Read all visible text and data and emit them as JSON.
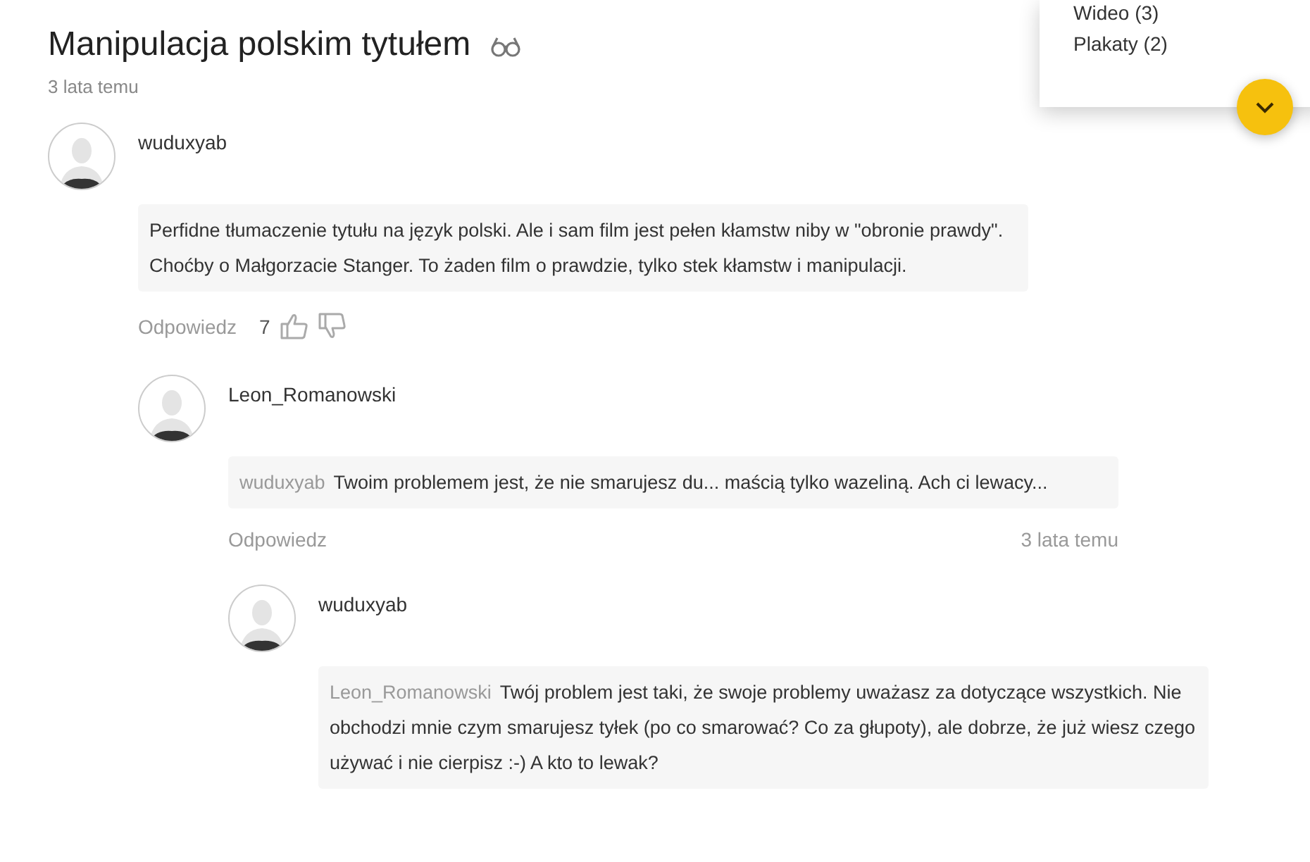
{
  "title": "Manipulacja polskim tytułem",
  "posted": "3 lata temu",
  "menu": {
    "items": [
      "Wideo (3)",
      "Plakaty (2)"
    ]
  },
  "comments": [
    {
      "author": "wuduxyab",
      "text": " Perfidne tłumaczenie tytułu na język polski. Ale i sam film jest pełen kłamstw niby w \"obronie prawdy\". Choćby o Małgorzacie Stanger. To żaden film o prawdzie, tylko stek kłamstw i manipulacji.",
      "reply_label": "Odpowiedz",
      "likes": "7",
      "children": [
        {
          "author": "Leon_Romanowski",
          "quote_author": "wuduxyab",
          "text": "Twoim problemem jest, że nie smarujesz du... maścią tylko wazeliną. Ach ci lewacy...",
          "reply_label": "Odpowiedz",
          "time": "3 lata temu",
          "children": [
            {
              "author": "wuduxyab",
              "quote_author": "Leon_Romanowski",
              "text": "Twój problem jest taki, że swoje problemy uważasz za dotyczące wszystkich. Nie obchodzi mnie czym smarujesz tyłek (po co smarować? Co za głupoty), ale dobrze, że już wiesz czego używać i nie cierpisz :-) A kto to lewak?"
            }
          ]
        }
      ]
    }
  ]
}
